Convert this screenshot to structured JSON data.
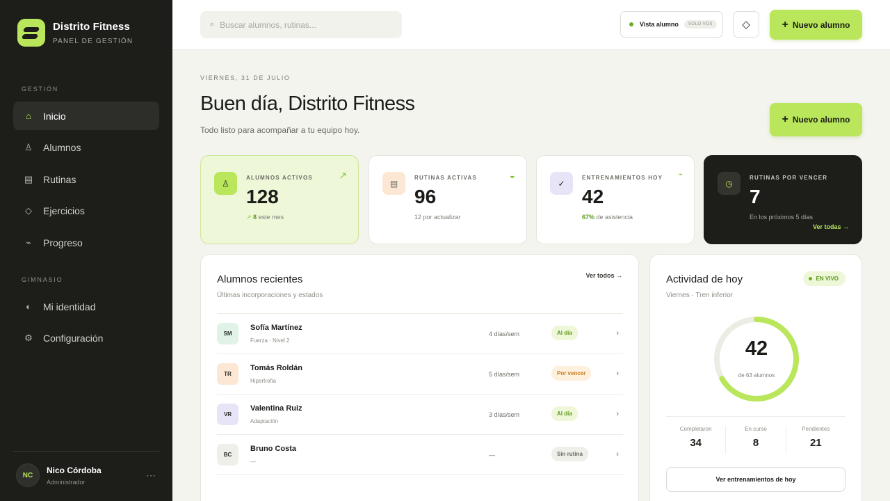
{
  "brand": {
    "name": "Distrito Fitness",
    "subtitle": "PANEL DE GESTIÓN"
  },
  "sidebar": {
    "section_management": "GESTIÓN",
    "section_gym": "GIMNASIO",
    "items": [
      {
        "label": "Inicio",
        "icon": "home-icon",
        "glyph": "⌂",
        "active": true
      },
      {
        "label": "Alumnos",
        "icon": "users-icon",
        "glyph": "♙"
      },
      {
        "label": "Rutinas",
        "icon": "list-icon",
        "glyph": "▤"
      },
      {
        "label": "Ejercicios",
        "icon": "diamond-icon",
        "glyph": "◇"
      },
      {
        "label": "Progreso",
        "icon": "activity-icon",
        "glyph": "⌁"
      },
      {
        "label": "Mi identidad",
        "icon": "contrast-icon",
        "glyph": "◐"
      },
      {
        "label": "Configuración",
        "icon": "gear-icon",
        "glyph": "⚙"
      }
    ],
    "user": {
      "initials": "NC",
      "name": "Nico Córdoba",
      "role": "Administrador",
      "more": "⋯"
    }
  },
  "topbar": {
    "search_placeholder": "Buscar alumnos, rutinas...",
    "view_label": "Vista alumno",
    "view_badge": "SOLO VOS",
    "theme_glyph": "◇",
    "new_student": "Nuevo alumno",
    "plus": "+"
  },
  "header": {
    "date": "VIERNES, 31 DE JULIO",
    "title": "Buen día, Distrito Fitness",
    "subtitle": "Todo listo para acompañar a tu equipo hoy.",
    "new_student": "Nuevo alumno",
    "plus": "+"
  },
  "stats": [
    {
      "label": "ALUMNOS ACTIVOS",
      "value": "128",
      "note_strong": "8",
      "note": " este mes",
      "note_prefix": "↗ ",
      "icon_glyph": "♙",
      "corner": "↗"
    },
    {
      "label": "RUTINAS ACTIVAS",
      "value": "96",
      "note": "12 por actualizar",
      "icon_glyph": "▤",
      "corner": "◒"
    },
    {
      "label": "ENTRENAMIENTOS HOY",
      "value": "42",
      "note_strong": "67%",
      "note": " de asistencia",
      "icon_glyph": "✓",
      "corner": "⌁"
    },
    {
      "label": "RUTINAS POR VENCER",
      "value": "7",
      "note": "En los próximos 5 días",
      "link": "Ver todas →",
      "icon_glyph": "◷"
    }
  ],
  "recent": {
    "title": "Alumnos recientes",
    "subtitle": "Últimas incorporaciones y estados",
    "link": "Ver todos →",
    "rows": [
      {
        "initials": "SM",
        "name": "Sofía Martínez",
        "meta": "Fuerza · Nivel 2",
        "freq": "4 días/sem",
        "status": "Al día",
        "tone": "ok",
        "avatar_bg": "#e0f3e6"
      },
      {
        "initials": "TR",
        "name": "Tomás Roldán",
        "meta": "Hipertrofia",
        "freq": "5 días/sem",
        "status": "Por vencer",
        "tone": "warn",
        "avatar_bg": "#fbe7d3"
      },
      {
        "initials": "VR",
        "name": "Valentina Ruiz",
        "meta": "Adaptación",
        "freq": "3 días/sem",
        "status": "Al día",
        "tone": "ok",
        "avatar_bg": "#e8e4f8"
      },
      {
        "initials": "BC",
        "name": "Bruno Costa",
        "meta": "—",
        "freq": "—",
        "status": "Sin rutina",
        "tone": "none",
        "avatar_bg": "#efefe9"
      }
    ],
    "chevron": "›"
  },
  "activity": {
    "title": "Actividad de hoy",
    "subtitle": "Viernes · Tren inferior",
    "live": "EN VIVO",
    "value": "42",
    "total_label": "de 63 alumnos",
    "progress": 0.667,
    "breakdown": [
      {
        "label": "Completaron",
        "value": "34"
      },
      {
        "label": "En curso",
        "value": "8"
      },
      {
        "label": "Pendientes",
        "value": "21"
      }
    ],
    "button": "Ver entrenamientos de hoy"
  },
  "colors": {
    "accent": "#b9e65a",
    "sidebar": "#1d1e1a",
    "ok_bg": "#eef7d8",
    "ok_fg": "#5e9a1f",
    "warn_bg": "#fdf0dc",
    "warn_fg": "#c97a1c",
    "none_bg": "#efefe9",
    "none_fg": "#6b6c65"
  }
}
